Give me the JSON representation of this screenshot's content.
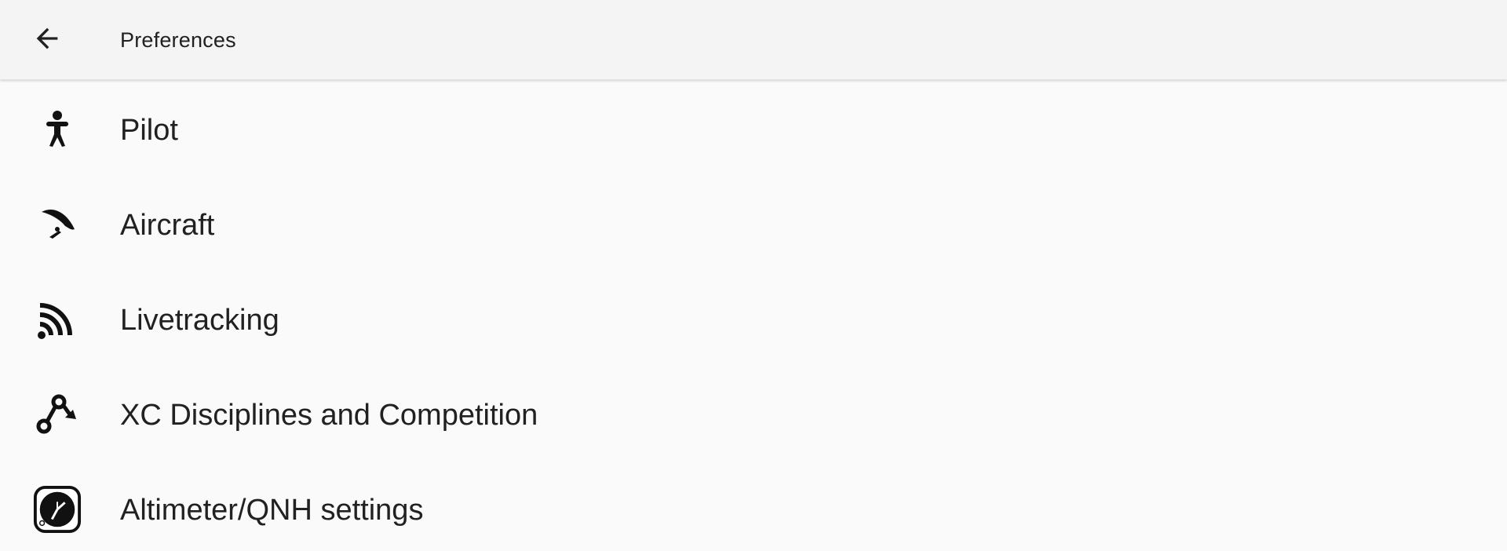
{
  "toolbar": {
    "title": "Preferences",
    "back_icon": "arrow-back-icon"
  },
  "preferences": {
    "items": [
      {
        "label": "Pilot",
        "icon": "pilot-icon"
      },
      {
        "label": "Aircraft",
        "icon": "paraglider-icon"
      },
      {
        "label": "Livetracking",
        "icon": "livetracking-signal-icon"
      },
      {
        "label": "XC Disciplines and Competition",
        "icon": "route-waypoints-icon"
      },
      {
        "label": "Altimeter/QNH settings",
        "icon": "altimeter-gauge-icon"
      }
    ]
  },
  "colors": {
    "toolbar_bg": "#f4f4f4",
    "page_bg": "#fafafa",
    "text": "#212121",
    "icon": "#111111"
  }
}
